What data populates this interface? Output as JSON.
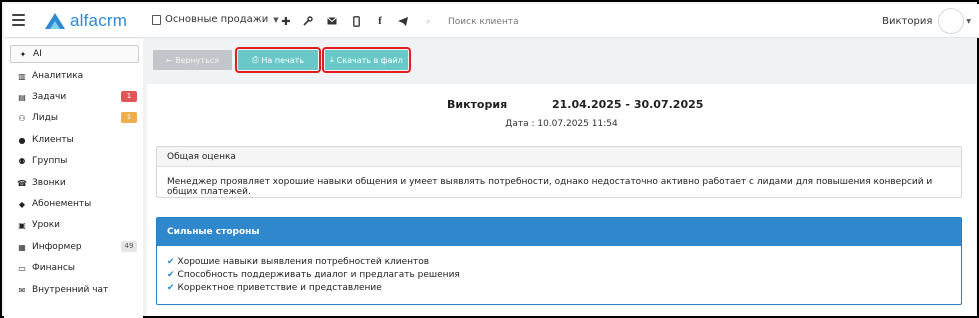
{
  "app": {
    "logo_text": "alfacrm",
    "brand_color": "#2f8bd1",
    "accent_color": "#69c9c8",
    "highlight_color": "#e02020"
  },
  "header": {
    "branch_label": "Основные продажи",
    "icons": [
      "plus-icon",
      "wrench-icon",
      "mail-icon",
      "mobile-icon",
      "facebook-icon",
      "telegram-icon"
    ],
    "search_placeholder": "Поиск клиента",
    "user_name": "Виктория"
  },
  "sidebar": {
    "items": [
      {
        "label": "AI",
        "icon": "sparkle-icon",
        "active": true
      },
      {
        "label": "Аналитика",
        "icon": "map-icon"
      },
      {
        "label": "Задачи",
        "icon": "clipboard-icon",
        "badge": "1",
        "badge_color": "#e05555"
      },
      {
        "label": "Лиды",
        "icon": "user-plus-icon",
        "badge": "1",
        "badge_color": "#f0ad4e"
      },
      {
        "label": "Клиенты",
        "icon": "user-icon"
      },
      {
        "label": "Группы",
        "icon": "users-icon"
      },
      {
        "label": "Звонки",
        "icon": "phone-icon"
      },
      {
        "label": "Абонементы",
        "icon": "tag-icon"
      },
      {
        "label": "Уроки",
        "icon": "calendar-icon"
      },
      {
        "label": "Информер",
        "icon": "list-icon",
        "badge": "49",
        "badge_color": "#e4e6e8"
      },
      {
        "label": "Финансы",
        "icon": "money-icon"
      },
      {
        "label": "Внутренний чат",
        "icon": "envelope-icon"
      }
    ]
  },
  "toolbar": {
    "back_label": "← Вернуться",
    "print_label": "На печать",
    "download_label": "Скачать в файл"
  },
  "report": {
    "name": "Виктория",
    "range": "21.04.2025 - 30.07.2025",
    "date_line": "Дата : 10.07.2025 11:54",
    "overall": {
      "title": "Общая оценка",
      "text": "Менеджер проявляет хорошие навыки общения и умеет выявлять потребности, однако недостаточно активно работает с лидами для повышения конверсий и общих платежей."
    },
    "strengths": {
      "title": "Сильные стороны",
      "items": [
        "Хорошие навыки выявления потребностей клиентов",
        "Способность поддерживать диалог и предлагать решения",
        "Корректное приветствие и представление"
      ]
    }
  }
}
